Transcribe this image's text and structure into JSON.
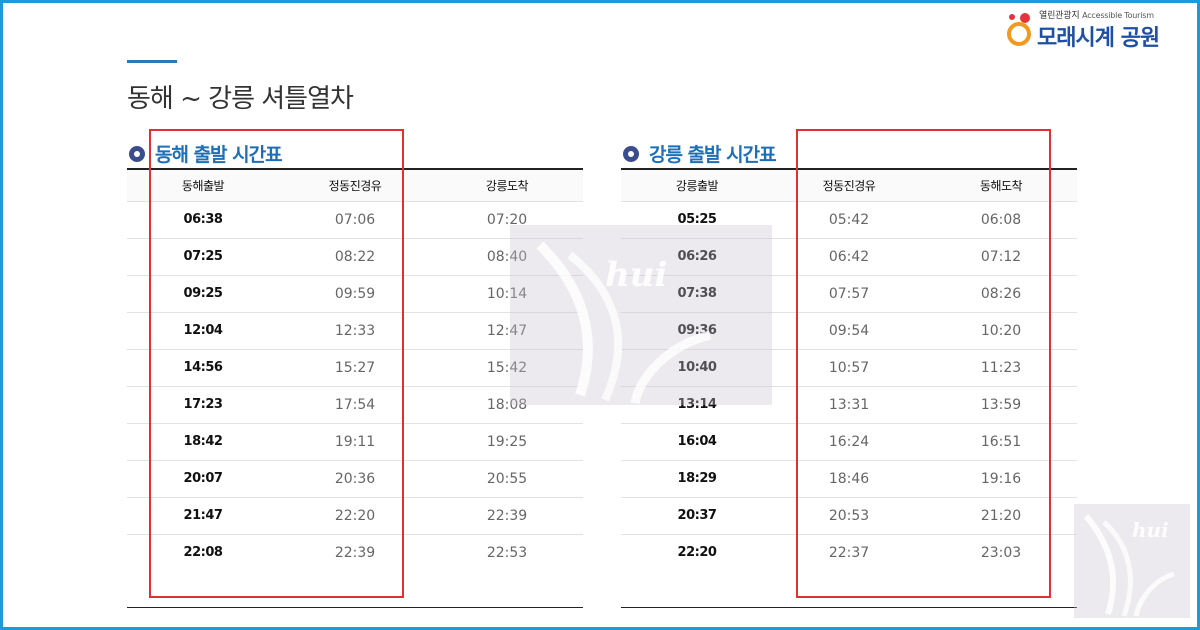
{
  "logo": {
    "tagline_ko": "열린관광지",
    "tagline_en": "Accessible Tourism",
    "name": "모래시계 공원",
    "colors": {
      "mark_red": "#e8323c",
      "mark_orange": "#f29a1f",
      "name": "#1f4fa3"
    }
  },
  "page_title": "동해 ~ 강릉 셔틀열차",
  "sections": [
    {
      "title": "동해 출발 시간표",
      "headers": [
        "동해출발",
        "정동진경유",
        "강릉도착"
      ],
      "rows": [
        [
          "06:38",
          "07:06",
          "07:20"
        ],
        [
          "07:25",
          "08:22",
          "08:40"
        ],
        [
          "09:25",
          "09:59",
          "10:14"
        ],
        [
          "12:04",
          "12:33",
          "12:47"
        ],
        [
          "14:56",
          "15:27",
          "15:42"
        ],
        [
          "17:23",
          "17:54",
          "18:08"
        ],
        [
          "18:42",
          "19:11",
          "19:25"
        ],
        [
          "20:07",
          "20:36",
          "20:55"
        ],
        [
          "21:47",
          "22:20",
          "22:39"
        ],
        [
          "22:08",
          "22:39",
          "22:53"
        ]
      ]
    },
    {
      "title": "강릉 출발 시간표",
      "headers": [
        "강릉출발",
        "정동진경유",
        "동해도착"
      ],
      "rows": [
        [
          "05:25",
          "05:42",
          "06:08"
        ],
        [
          "06:26",
          "06:42",
          "07:12"
        ],
        [
          "07:38",
          "07:57",
          "08:26"
        ],
        [
          "09:36",
          "09:54",
          "10:20"
        ],
        [
          "10:40",
          "10:57",
          "11:23"
        ],
        [
          "13:14",
          "13:31",
          "13:59"
        ],
        [
          "16:04",
          "16:24",
          "16:51"
        ],
        [
          "18:29",
          "18:46",
          "19:16"
        ],
        [
          "20:37",
          "20:53",
          "21:20"
        ],
        [
          "22:20",
          "22:37",
          "23:03"
        ]
      ]
    }
  ],
  "watermark_text": "hui",
  "colors": {
    "frame": "#1b9bd7",
    "highlight": "#e03030",
    "section_title": "#1d6fb8"
  }
}
